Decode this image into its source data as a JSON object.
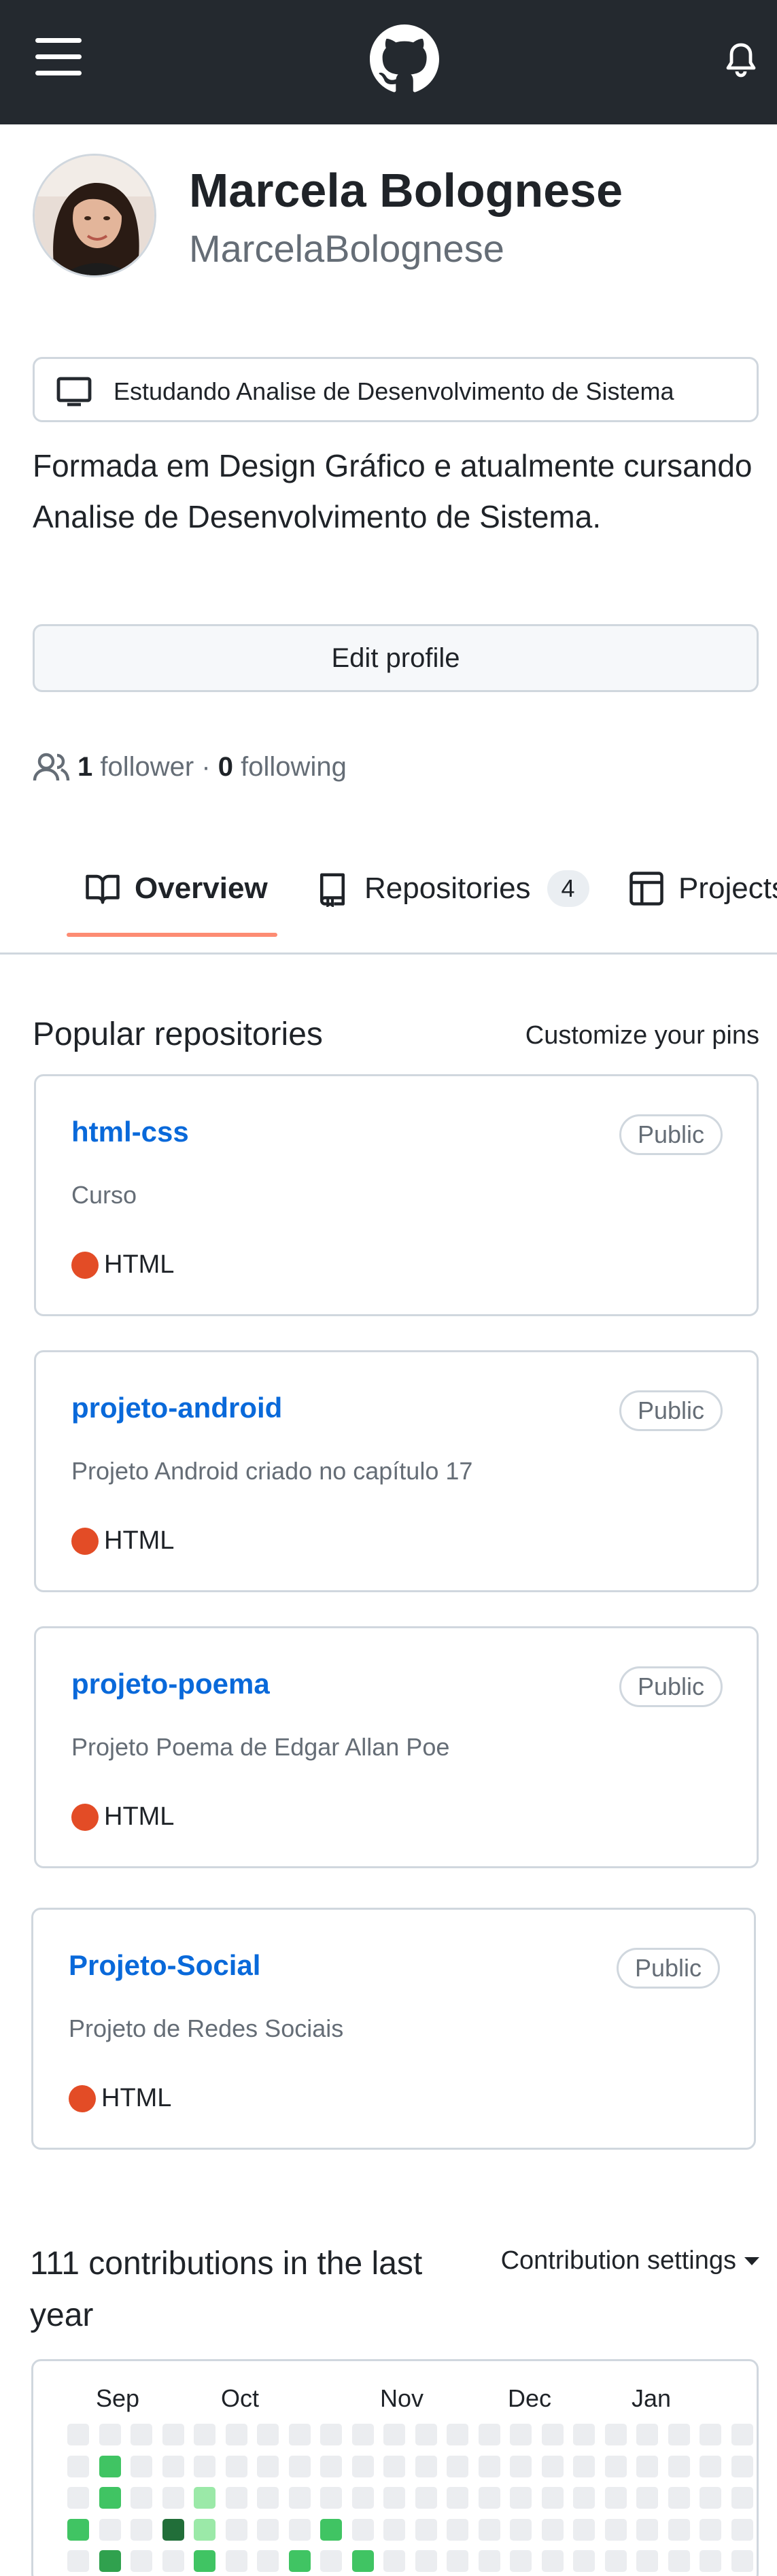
{
  "header": {
    "menu_icon": "hamburger-menu-icon",
    "logo_icon": "github-octocat-icon",
    "notifications_icon": "bell-icon"
  },
  "profile": {
    "name": "Marcela Bolognese",
    "login": "MarcelaBolognese",
    "status": "Estudando Analise de Desenvolvimento de Sistema",
    "bio": "Formada em Design Gráfico e atualmente cursando Analise de Desenvolvimento de Sistema.",
    "edit_label": "Edit profile",
    "followers_count": "1",
    "followers_label": "follower",
    "separator": "·",
    "following_count": "0",
    "following_label": "following"
  },
  "tabs": [
    {
      "label": "Overview",
      "icon": "book-icon",
      "selected": true
    },
    {
      "label": "Repositories",
      "icon": "repo-icon",
      "count": "4"
    },
    {
      "label": "Projects",
      "icon": "table-icon"
    }
  ],
  "popular": {
    "title": "Popular repositories",
    "customize_label": "Customize your pins",
    "repos": [
      {
        "name": "html-css",
        "visibility": "Public",
        "description": "Curso",
        "language": "HTML"
      },
      {
        "name": "projeto-android",
        "visibility": "Public",
        "description": "Projeto Android criado no capítulo 17",
        "language": "HTML"
      },
      {
        "name": "projeto-poema",
        "visibility": "Public",
        "description": "Projeto Poema de Edgar Allan Poe",
        "language": "HTML"
      },
      {
        "name": "Projeto-Social",
        "visibility": "Public",
        "description": "Projeto de Redes Sociais",
        "language": "HTML"
      }
    ]
  },
  "contributions": {
    "title": "111 contributions in the last year",
    "settings_label": "Contribution settings",
    "months": [
      "Sep",
      "Oct",
      "Nov",
      "Dec",
      "Jan"
    ],
    "rows": [
      [
        0,
        0,
        0,
        0,
        0,
        0,
        0,
        0,
        0,
        0,
        0,
        0,
        0,
        0,
        0,
        0,
        0,
        0,
        0,
        0,
        0,
        0
      ],
      [
        0,
        2,
        0,
        0,
        0,
        0,
        0,
        0,
        0,
        0,
        0,
        0,
        0,
        0,
        0,
        0,
        0,
        0,
        0,
        0,
        0,
        0
      ],
      [
        0,
        2,
        0,
        0,
        1,
        0,
        0,
        0,
        0,
        0,
        0,
        0,
        0,
        0,
        0,
        0,
        0,
        0,
        0,
        0,
        0,
        0
      ],
      [
        2,
        0,
        0,
        4,
        1,
        0,
        0,
        0,
        2,
        0,
        0,
        0,
        0,
        0,
        0,
        0,
        0,
        0,
        0,
        0,
        0,
        0
      ],
      [
        0,
        3,
        0,
        0,
        2,
        0,
        0,
        2,
        0,
        2,
        0,
        0,
        0,
        0,
        0,
        0,
        0,
        0,
        0,
        0,
        0,
        0
      ]
    ]
  },
  "colors": {
    "header_bg": "#24292f",
    "link": "#0969da",
    "tab_underline": "#fd8c73",
    "html_language": "#e34c26",
    "contrib_levels": [
      "#ebedf0",
      "#9be9a8",
      "#40c463",
      "#30a14e",
      "#216e39"
    ]
  }
}
